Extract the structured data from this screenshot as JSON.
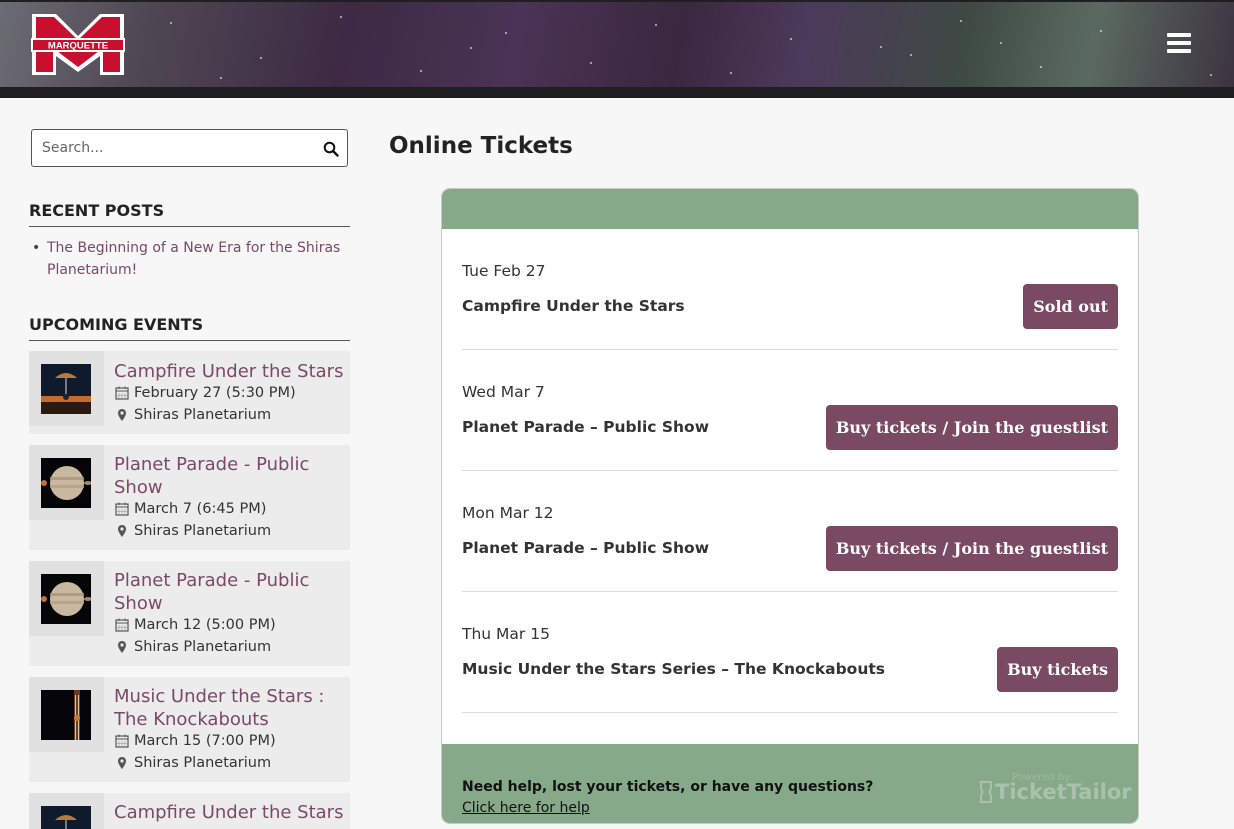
{
  "header": {
    "logo_text": "MARQUETTE",
    "menu_icon": "hamburger-menu-icon"
  },
  "sidebar": {
    "search": {
      "placeholder": "Search..."
    },
    "recent_posts": {
      "heading": "RECENT POSTS",
      "items": [
        {
          "label": "The Beginning of a New Era for the Shiras Planetarium!"
        }
      ]
    },
    "upcoming_events": {
      "heading": "UPCOMING EVENTS",
      "items": [
        {
          "title": "Campfire Under the Stars",
          "date": "February 27 (5:30 PM)",
          "location": "Shiras Planetarium"
        },
        {
          "title": "Planet Parade - Public Show",
          "date": "March 7 (6:45 PM)",
          "location": "Shiras Planetarium"
        },
        {
          "title": "Planet Parade - Public Show",
          "date": "March 12 (5:00 PM)",
          "location": "Shiras Planetarium"
        },
        {
          "title": "Music Under the Stars : The Knockabouts",
          "date": "March 15 (7:00 PM)",
          "location": "Shiras Planetarium"
        },
        {
          "title": "Campfire Under the Stars"
        }
      ]
    }
  },
  "main": {
    "title": "Online Tickets",
    "tickets": [
      {
        "date": "Tue Feb 27",
        "name": "Campfire Under the Stars",
        "button": "Sold out"
      },
      {
        "date": "Wed Mar 7",
        "name": "Planet Parade – Public Show",
        "button": "Buy tickets / Join the guestlist"
      },
      {
        "date": "Mon Mar 12",
        "name": "Planet Parade – Public Show",
        "button": "Buy tickets / Join the guestlist"
      },
      {
        "date": "Thu Mar 15",
        "name": "Music Under the Stars Series – The Knockabouts",
        "button": "Buy tickets"
      }
    ],
    "footer": {
      "help_question": "Need help, lost your tickets, or have any questions?",
      "help_link": "Click here for help",
      "powered_by": "Powered by:",
      "brand": "TicketTailor"
    }
  },
  "colors": {
    "accent": "#7a4a63",
    "widget_green": "#86a98a"
  }
}
